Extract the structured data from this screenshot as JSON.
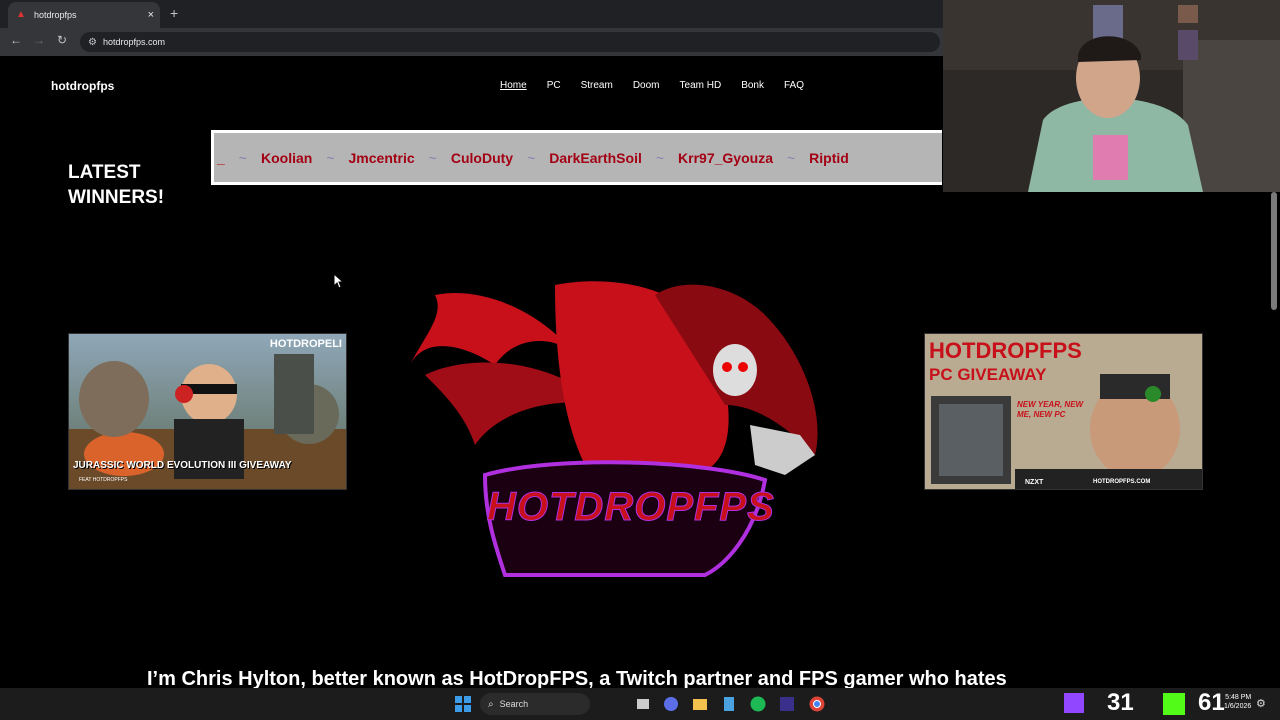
{
  "browser": {
    "tab_title": "hotdropfps",
    "tab_close": "×",
    "new_tab": "+",
    "url": "hotdropfps.com"
  },
  "site": {
    "logo_text": "hotdropfps",
    "nav": [
      "Home",
      "PC",
      "Stream",
      "Doom",
      "Team HD",
      "Bonk",
      "FAQ"
    ],
    "winners_title": "LATEST WINNERS!",
    "ticker_lead": "_",
    "ticker_separator": "~",
    "winners": [
      "Koolian",
      "Jmcentric",
      "CuloDuty",
      "DarkEarthSoil",
      "Krr97_Gyouza",
      "Riptid"
    ],
    "left_promo": {
      "corner_text": "HOTDROPELI",
      "caption": "JURASSIC WORLD EVOLUTION III GIVEAWAY",
      "footer": "FEAT HOTDROPFPS"
    },
    "right_promo": {
      "headline": "HOTDROPFPS",
      "subhead": "PC GIVEAWAY",
      "tagline": "NEW YEAR, NEW ME, NEW PC",
      "brand": "NZXT",
      "site": "HOTDROPFPS.COM"
    },
    "mascot_text": "HOTDROPFPS",
    "bio_text": "I’m Chris Hylton, better known as HotDropFPS, a Twitch partner and FPS gamer who hates"
  },
  "taskbar": {
    "search_label": "Search",
    "tray_left_number": "31",
    "tray_right_number": "61",
    "time": "5:48 PM",
    "date": "1/6/2026"
  },
  "colors": {
    "accent_red": "#a30013",
    "ticker_bg": "#b5b5b5",
    "mascot_purple": "#b030e0"
  }
}
